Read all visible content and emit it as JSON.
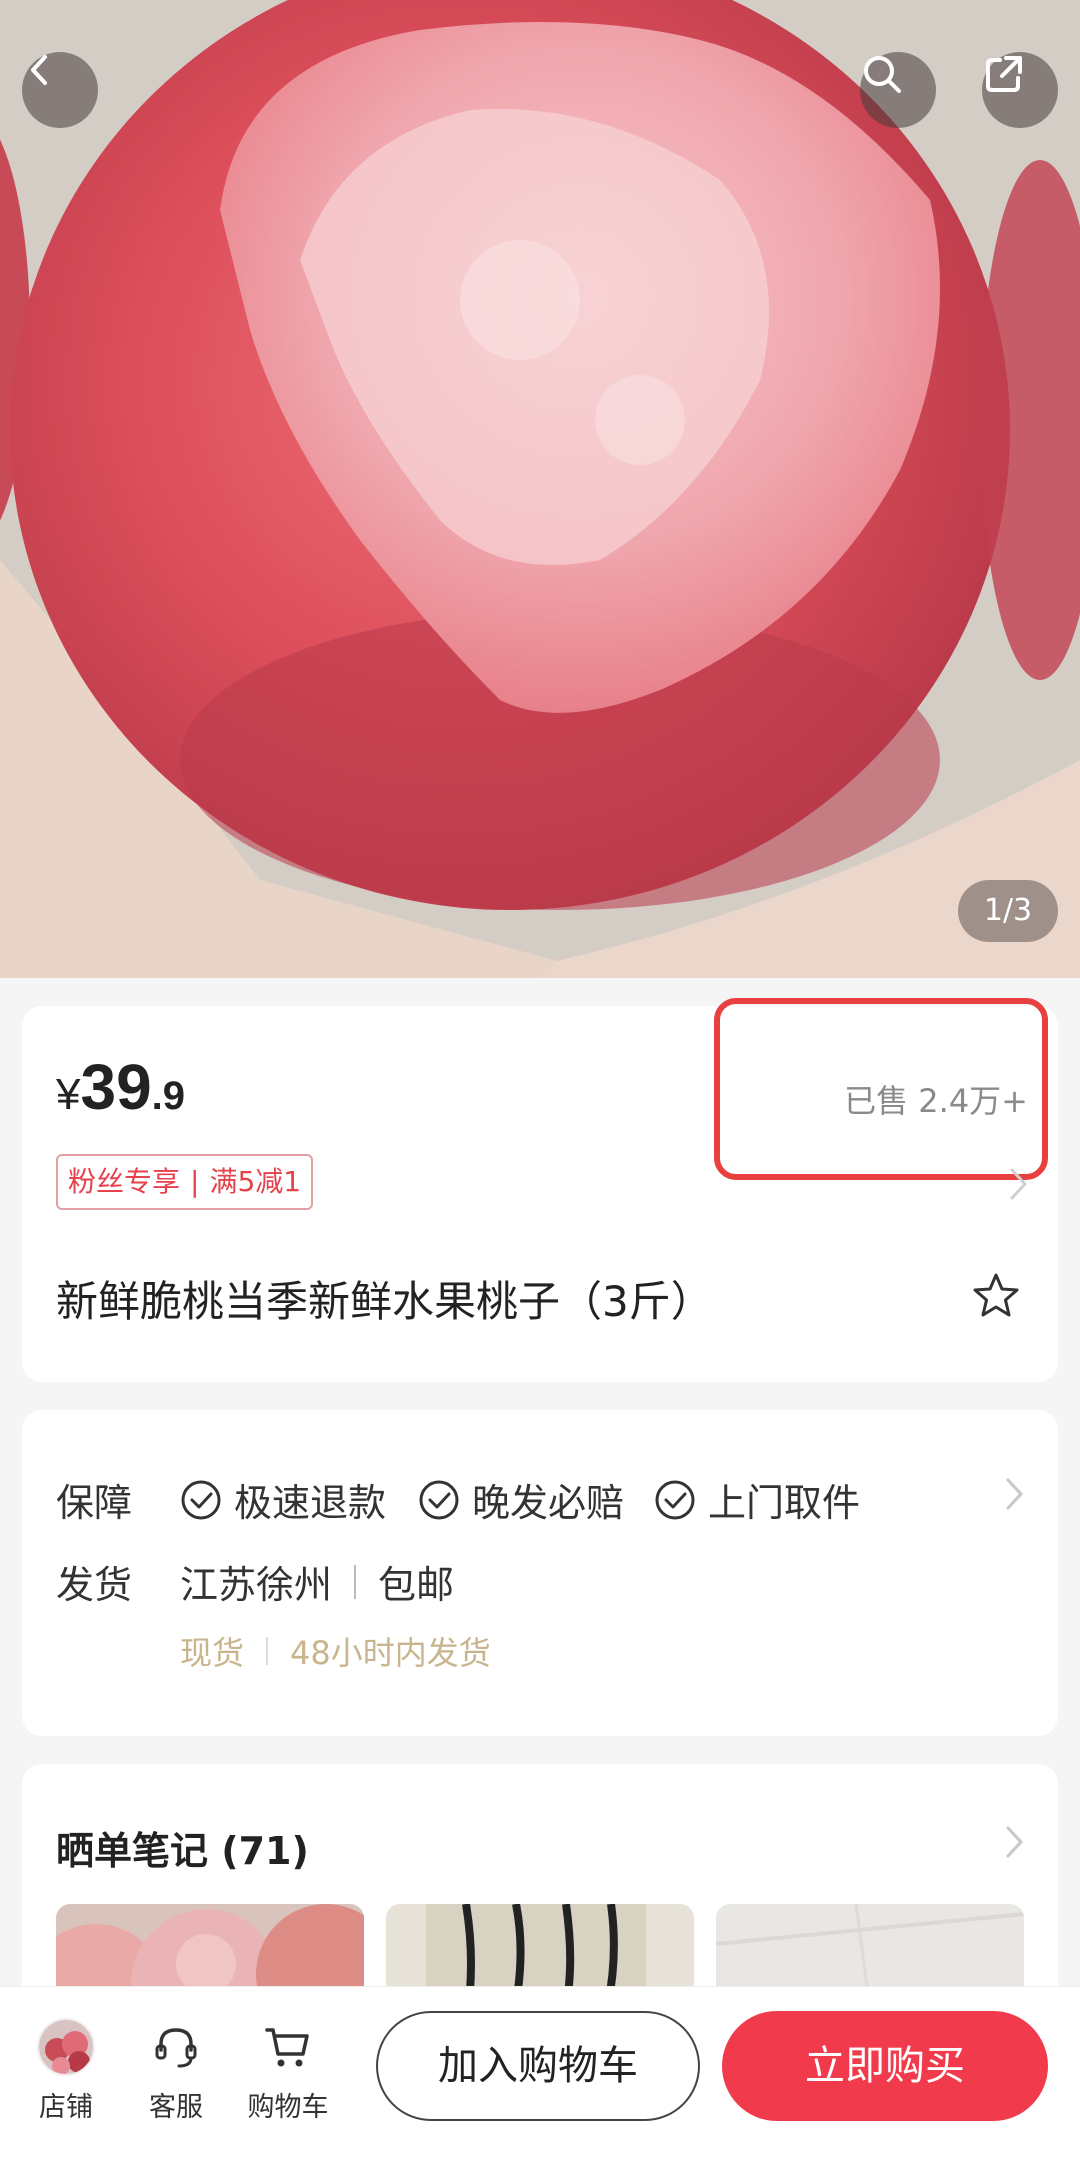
{
  "hero": {
    "image_counter": "1/3"
  },
  "product": {
    "currency": "¥",
    "price_integer": "39",
    "price_decimal": ".9",
    "sold_count": "已售 2.4万+",
    "coupon": {
      "tag": "粉丝专享",
      "separator": "|",
      "offer": "满5减1"
    },
    "title": "新鲜脆桃当季新鲜水果桃子（3斤）"
  },
  "service": {
    "guarantee_label": "保障",
    "guarantees": [
      "极速退款",
      "晚发必赔",
      "上门取件"
    ],
    "shipping_label": "发货",
    "origin": "江苏徐州",
    "shipping_fee": "包邮",
    "stock_status": "现货",
    "dispatch_time": "48小时内发货"
  },
  "notes": {
    "title": "晒单笔记 (71)"
  },
  "bottom_bar": {
    "store_label": "店铺",
    "service_label": "客服",
    "cart_label": "购物车",
    "add_to_cart": "加入购物车",
    "buy_now": "立即购买"
  },
  "colors": {
    "accent_red": "#f23a4d",
    "highlight_box": "#e8403e",
    "coupon_text": "#e6424d",
    "muted_gold": "#c9b58d"
  }
}
